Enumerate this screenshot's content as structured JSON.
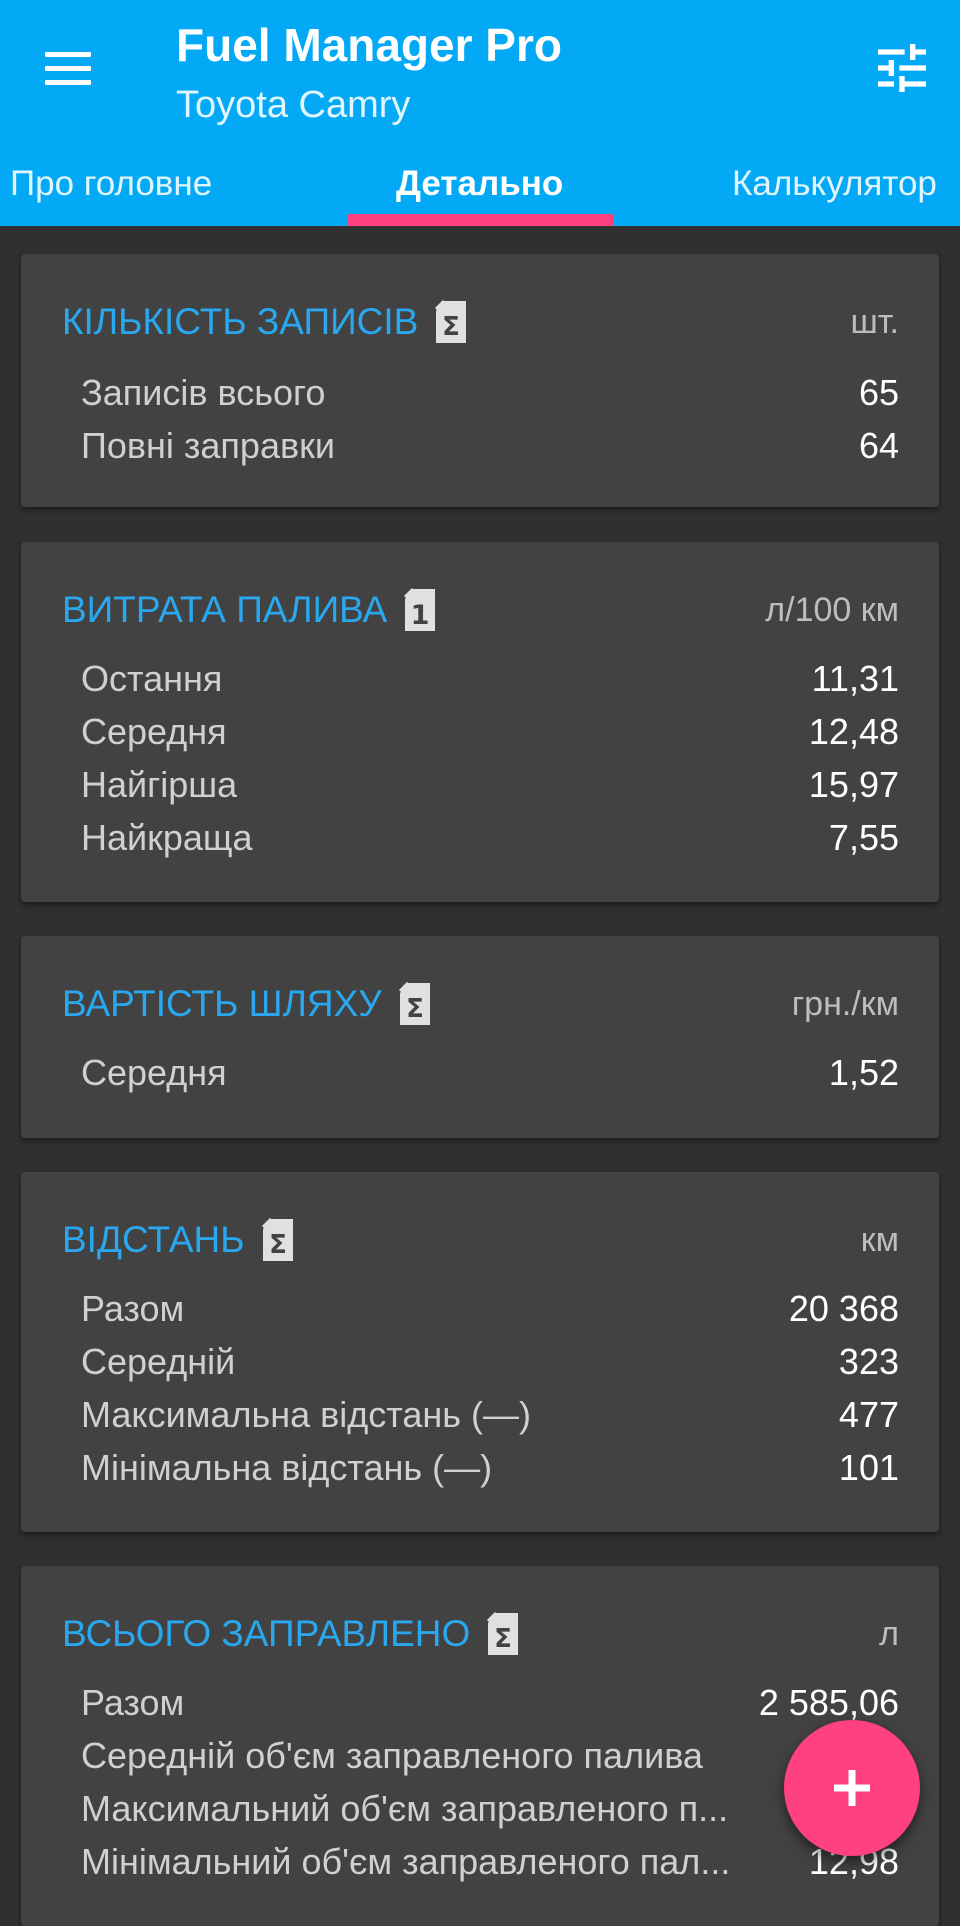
{
  "app": {
    "title": "Fuel Manager Pro",
    "subtitle": "Toyota Camry"
  },
  "icons": {
    "menu": "menu-icon",
    "filter": "tune-icon",
    "sum": "jerrycan-sigma-icon",
    "last": "jerrycan-one-icon",
    "add": "plus-icon"
  },
  "colors": {
    "appbar": "#03A9F4",
    "accent": "#FF4081",
    "section_title": "#29A8F0",
    "card": "#424242",
    "background": "#303030"
  },
  "tabs": [
    {
      "label": "Про головне"
    },
    {
      "label": "Детально"
    },
    {
      "label": "Калькулятор"
    }
  ],
  "active_tab": "Детально",
  "cards": [
    {
      "title": "КІЛЬКІСТЬ ЗАПИСІВ",
      "unit": "шт.",
      "icon": "jerrycan-sigma-icon",
      "rows": [
        {
          "label": "Записів всього",
          "value": "65"
        },
        {
          "label": "Повні заправки",
          "value": "64"
        }
      ]
    },
    {
      "title": "ВИТРАТА ПАЛИВА",
      "unit": "л/100 км",
      "icon": "jerrycan-one-icon",
      "rows": [
        {
          "label": "Остання",
          "value": "11,31"
        },
        {
          "label": "Середня",
          "value": "12,48"
        },
        {
          "label": "Найгірша",
          "value": "15,97"
        },
        {
          "label": "Найкраща",
          "value": "7,55"
        }
      ]
    },
    {
      "title": "ВАРТІСТЬ ШЛЯХУ",
      "unit": "грн./км",
      "icon": "jerrycan-sigma-icon",
      "rows": [
        {
          "label": "Середня",
          "value": "1,52"
        }
      ]
    },
    {
      "title": "ВІДСТАНЬ",
      "unit": "км",
      "icon": "jerrycan-sigma-icon",
      "rows": [
        {
          "label": "Разом",
          "value": "20 368"
        },
        {
          "label": "Середній",
          "value": "323"
        },
        {
          "label": "Максимальна відстань (—)",
          "value": "477"
        },
        {
          "label": "Мінімальна відстань (—)",
          "value": "101"
        }
      ]
    },
    {
      "title": "ВСЬОГО ЗАПРАВЛЕНО",
      "unit": "л",
      "icon": "jerrycan-sigma-icon",
      "rows": [
        {
          "label": "Разом",
          "value": "2 585,06"
        },
        {
          "label": "Середній об'єм заправленого палива",
          "value": ""
        },
        {
          "label": "Максимальний об'єм заправленого п...",
          "value": ""
        },
        {
          "label": "Мінімальний об'єм заправленого пал...",
          "value": "12,98"
        }
      ]
    }
  ]
}
